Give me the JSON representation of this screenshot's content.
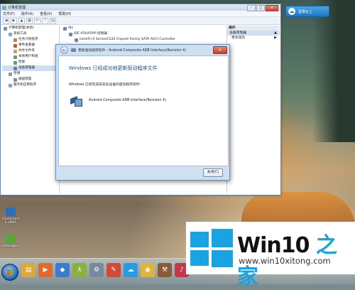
{
  "desktop": {
    "cloud_button": {
      "label": "登录云上",
      "icon": "cloud-icon"
    },
    "icons": [
      {
        "label": "Dashboard\n6.2M05",
        "icon": "dashboard-icon",
        "color": "#2b6fb8"
      },
      {
        "label": "DxDesigner",
        "icon": "dxdesigner-icon",
        "color": "#5aa63a"
      }
    ]
  },
  "mmc": {
    "title": "计算机管理",
    "menu": [
      "文件(F)",
      "操作(A)",
      "查看(V)",
      "帮助(H)"
    ],
    "toolbar_icons": [
      "back-icon",
      "forward-icon",
      "up-icon",
      "view-icon",
      "refresh-icon",
      "help-icon",
      "properties-icon"
    ],
    "tree": [
      {
        "label": "计算机管理(本地)",
        "level": 0,
        "color": "#7d8ea3"
      },
      {
        "label": "系统工具",
        "level": 1,
        "color": "#8aa0b8"
      },
      {
        "label": "任务计划程序",
        "level": 2,
        "color": "#b38a3e"
      },
      {
        "label": "事件查看器",
        "level": 2,
        "color": "#a85c4c"
      },
      {
        "label": "共享文件夹",
        "level": 2,
        "color": "#c9a345"
      },
      {
        "label": "本地用户和组",
        "level": 2,
        "color": "#6e8fb0"
      },
      {
        "label": "性能",
        "level": 2,
        "color": "#6b9a55"
      },
      {
        "label": "设备管理器",
        "level": 2,
        "color": "#5d7fa6"
      },
      {
        "label": "存储",
        "level": 1,
        "color": "#8a96a6"
      },
      {
        "label": "磁盘管理",
        "level": 2,
        "color": "#7b8da3"
      },
      {
        "label": "服务和应用程序",
        "level": 1,
        "color": "#8d9db2"
      }
    ],
    "device_tree": [
      {
        "label": "dlx",
        "level": 0
      },
      {
        "label": "IDE ATA/ATAPI 控制器",
        "level": 1
      },
      {
        "label": "Intel(R) 6 Series/C220 Chipset Family SATA AHCI Controller",
        "level": 2
      }
    ],
    "actions": {
      "header": "操作",
      "selected": "设备管理器",
      "more": "更多操作"
    }
  },
  "dialog": {
    "title": "更新驱动程序软件 - Android Composite ADB Interface(Revision 4)",
    "heading": "Windows 已经成功地更新驱动程序文件",
    "message": "Windows 已经完成安装此设备的驱动程序软件:",
    "device_name": "Android Composite ADB Interface(Revision 4)",
    "close_button": "关闭(C)"
  },
  "taskbar": {
    "apps": [
      {
        "icon": "explorer-icon",
        "color": "#d9a93a"
      },
      {
        "icon": "media-player-icon",
        "color": "#e06a2a"
      },
      {
        "icon": "app-icon",
        "color": "#3c7bd1"
      },
      {
        "icon": "lambda-icon",
        "color": "#8ab03e"
      },
      {
        "icon": "device-manager-icon",
        "color": "#7a8a9c"
      },
      {
        "icon": "paint-icon",
        "color": "#d04a3a"
      },
      {
        "icon": "cloud-sync-icon",
        "color": "#2a9be0"
      },
      {
        "icon": "chrome-icon",
        "color": "#e0b33a"
      },
      {
        "icon": "tools-icon",
        "color": "#8a5b3a"
      },
      {
        "icon": "media-icon",
        "color": "#c23a4a"
      }
    ]
  },
  "watermark": {
    "title_prefix": "Win10",
    "title_suffix": " 之家",
    "url": "www.win10xitong.com"
  }
}
